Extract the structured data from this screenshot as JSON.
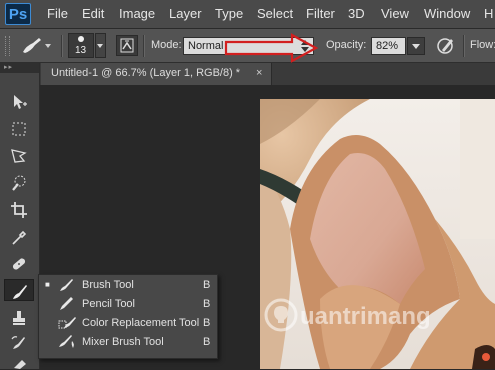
{
  "app": {
    "logo": "Ps"
  },
  "menu": [
    "File",
    "Edit",
    "Image",
    "Layer",
    "Type",
    "Select",
    "Filter",
    "3D",
    "View",
    "Window",
    "H"
  ],
  "options": {
    "brush_size": "13",
    "mode_label": "Mode:",
    "mode_value": "Normal",
    "opacity_label": "Opacity:",
    "opacity_value": "82%",
    "flow_label": "Flow:"
  },
  "document": {
    "tab_title": "Untitled-1 @ 66.7% (Layer 1, RGB/8) *",
    "close_glyph": "×"
  },
  "toolbox": {
    "tools": [
      "move-tool",
      "marquee-tool",
      "lasso-tool",
      "quick-selection-tool",
      "crop-tool",
      "eyedropper-tool",
      "spot-healing-tool",
      "brush-tool",
      "clone-stamp-tool",
      "history-brush-tool",
      "eraser-tool"
    ],
    "active": "brush-tool"
  },
  "flyout": {
    "items": [
      {
        "label": "Brush Tool",
        "key": "B",
        "selected": true,
        "icon": "brush-icon"
      },
      {
        "label": "Pencil Tool",
        "key": "B",
        "selected": false,
        "icon": "pencil-icon"
      },
      {
        "label": "Color Replacement Tool",
        "key": "B",
        "selected": false,
        "icon": "color-replacement-icon"
      },
      {
        "label": "Mixer Brush Tool",
        "key": "B",
        "selected": false,
        "icon": "mixer-brush-icon"
      }
    ],
    "bullet": "■"
  },
  "annotation": {
    "color": "#d21f1f"
  },
  "watermark": {
    "text": "uantrimang"
  }
}
